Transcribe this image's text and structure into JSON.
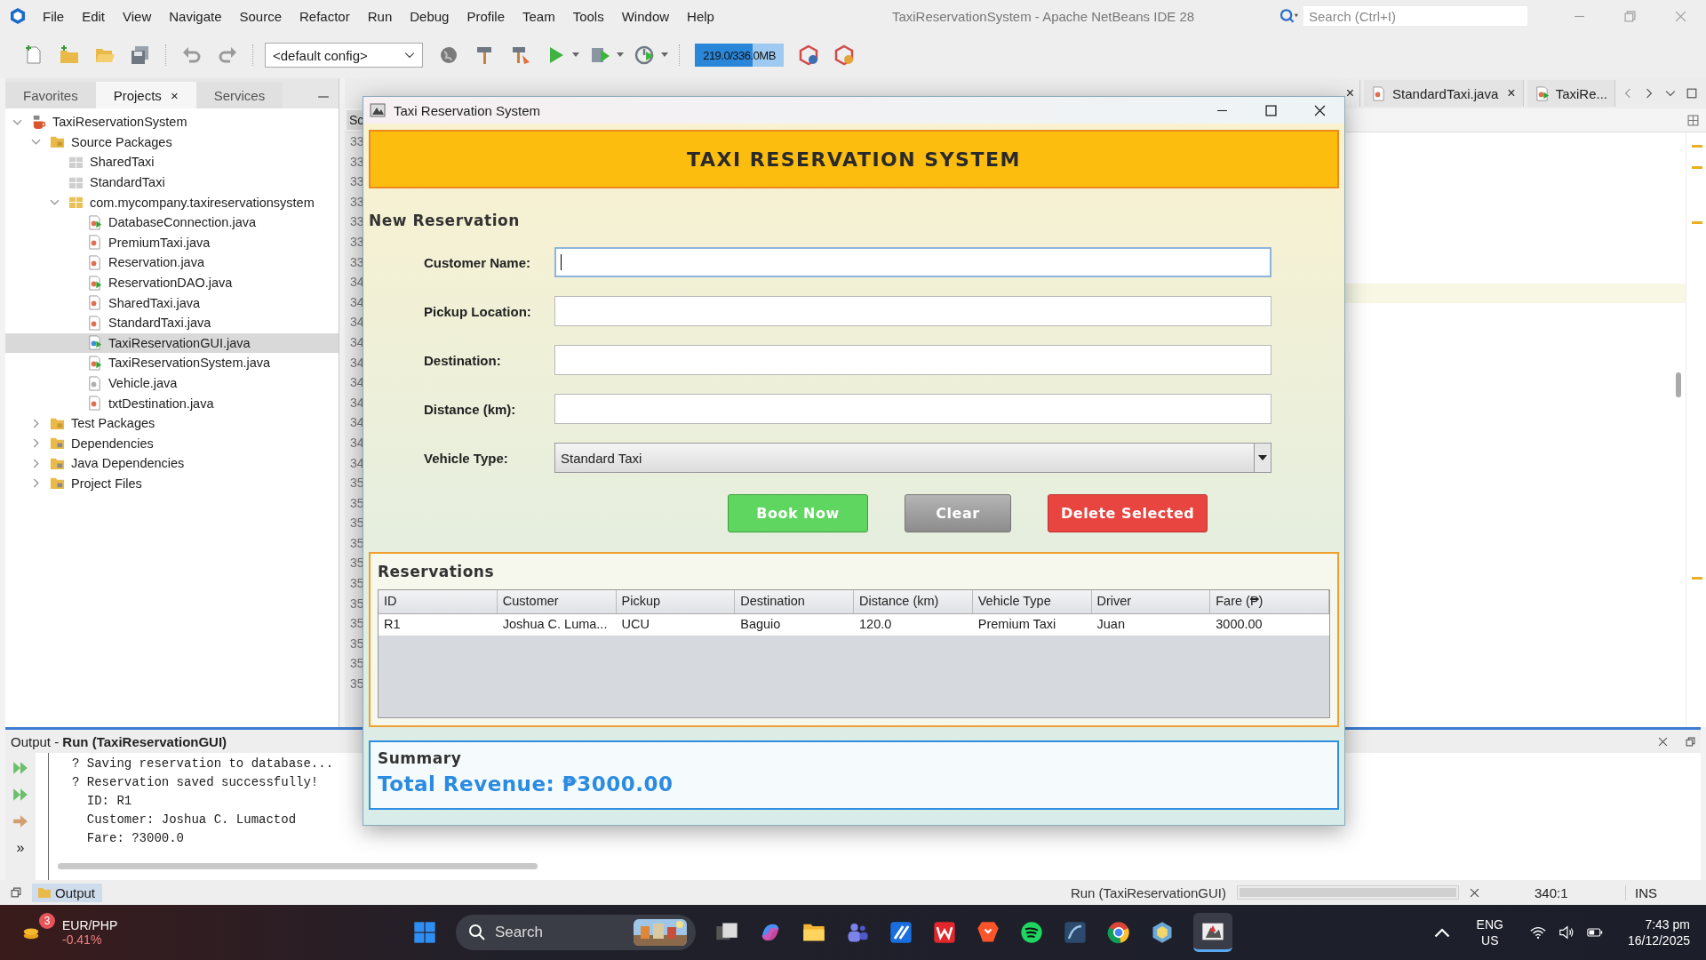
{
  "ide": {
    "title": "TaxiReservationSystem - Apache NetBeans IDE 28",
    "menu": [
      "File",
      "Edit",
      "View",
      "Navigate",
      "Source",
      "Refactor",
      "Run",
      "Debug",
      "Profile",
      "Team",
      "Tools",
      "Window",
      "Help"
    ],
    "search": {
      "placeholder": "Search (Ctrl+I)"
    },
    "config": "<default config>",
    "memory": {
      "text": "219.0/336.0MB",
      "level": 0.65
    }
  },
  "panel_tabs": [
    {
      "label": "Favorites",
      "selected": false
    },
    {
      "label": "Projects",
      "selected": true,
      "close": "×"
    },
    {
      "label": "Services",
      "selected": false
    }
  ],
  "tree": [
    {
      "label": "TaxiReservationSystem",
      "kind": "project",
      "expanded": true,
      "selected": false,
      "children": [
        {
          "label": "Source Packages",
          "kind": "folder",
          "expanded": true,
          "selected": false,
          "children": [
            {
              "label": "SharedTaxi",
              "kind": "empty-package",
              "selected": false
            },
            {
              "label": "StandardTaxi",
              "kind": "empty-package",
              "selected": false
            },
            {
              "label": "com.mycompany.taxireservationsystem",
              "kind": "package",
              "expanded": true,
              "selected": false,
              "children": [
                {
                  "label": "DatabaseConnection.java",
                  "kind": "main-class",
                  "selected": false
                },
                {
                  "label": "PremiumTaxi.java",
                  "kind": "class",
                  "selected": false
                },
                {
                  "label": "Reservation.java",
                  "kind": "class",
                  "selected": false
                },
                {
                  "label": "ReservationDAO.java",
                  "kind": "main-class",
                  "selected": false
                },
                {
                  "label": "SharedTaxi.java",
                  "kind": "class",
                  "selected": false
                },
                {
                  "label": "StandardTaxi.java",
                  "kind": "class",
                  "selected": false
                },
                {
                  "label": "TaxiReservationGUI.java",
                  "kind": "form",
                  "selected": true
                },
                {
                  "label": "TaxiReservationSystem.java",
                  "kind": "main-class",
                  "selected": false
                },
                {
                  "label": "Vehicle.java",
                  "kind": "abstract-class",
                  "selected": false
                },
                {
                  "label": "txtDestination.java",
                  "kind": "class",
                  "selected": false
                }
              ]
            }
          ]
        },
        {
          "label": "Test Packages",
          "kind": "folder",
          "expanded": false,
          "selected": false
        },
        {
          "label": "Dependencies",
          "kind": "library",
          "expanded": false,
          "selected": false
        },
        {
          "label": "Java Dependencies",
          "kind": "library",
          "expanded": false,
          "selected": false
        },
        {
          "label": "Project Files",
          "kind": "library",
          "expanded": false,
          "selected": false
        }
      ]
    }
  ],
  "editor": {
    "tabs": [
      {
        "close": "×",
        "selected": false
      },
      {
        "label": "StandardTaxi.java",
        "close": "×",
        "kind": "class",
        "selected": false
      },
      {
        "label": "TaxiRe...",
        "kind": "main-class",
        "selected": false
      }
    ],
    "view_tab": "Sc",
    "line_numbers": [
      "33",
      "33",
      "33",
      "33",
      "33",
      "33",
      "33",
      "34",
      "34",
      "34",
      "34",
      "34",
      "34",
      "34",
      "34",
      "34",
      "34",
      "35",
      "35",
      "35",
      "35",
      "35",
      "35",
      "35",
      "35",
      "35",
      "35",
      "35"
    ]
  },
  "output": {
    "title": "Output - **Run (TaxiReservationGUI)**",
    "lines": [
      "? Saving reservation to database...",
      "? Reservation saved successfully!",
      "  ID: R1",
      "  Customer: Joshua C. Lumactod",
      "  Fare: ?3000.0"
    ],
    "more": "»"
  },
  "status_bar": {
    "output_tab": "Output",
    "task": "Run (TaxiReservationGUI)",
    "position": "340:1",
    "mode": "INS",
    "progress": {
      "level": 1
    }
  },
  "dialog": {
    "title": "Taxi Reservation System",
    "header": "TAXI RESERVATION SYSTEM",
    "section": "New Reservation",
    "fields": [
      {
        "label": "Customer Name:",
        "kind": "text",
        "focused": true
      },
      {
        "label": "Pickup Location:",
        "kind": "text",
        "focused": false
      },
      {
        "label": "Destination:",
        "kind": "text",
        "focused": false
      },
      {
        "label": "Distance (km):",
        "kind": "text",
        "focused": false
      },
      {
        "label": "Vehicle Type:",
        "kind": "select",
        "value": "Standard Taxi",
        "focused": false
      }
    ],
    "buttons": [
      {
        "label": "Book Now",
        "kind": "primary"
      },
      {
        "label": "Clear",
        "kind": "neutral"
      },
      {
        "label": "Delete Selected",
        "kind": "danger"
      }
    ],
    "reservations": {
      "title": "Reservations",
      "columns": [
        "ID",
        "Customer",
        "Pickup",
        "Destination",
        "Distance (km)",
        "Vehicle Type",
        "Driver",
        "Fare (₱)"
      ],
      "rows": [
        {
          "selected": false,
          "cells": [
            "R1",
            "Joshua C. Luma...",
            "UCU",
            "Baguio",
            "120.0",
            "Premium Taxi",
            "Juan",
            "3000.00"
          ]
        }
      ]
    },
    "summary": {
      "title": "Summary",
      "total": "Total Revenue: ₱3000.00"
    }
  },
  "taskbar": {
    "widget": {
      "name": "EUR/PHP",
      "change": "-0.41%",
      "badge": "3"
    },
    "search": {
      "placeholder": "Search"
    },
    "language": [
      "ENG",
      "US"
    ],
    "time": "7:43 pm",
    "date": "16/12/2025"
  }
}
